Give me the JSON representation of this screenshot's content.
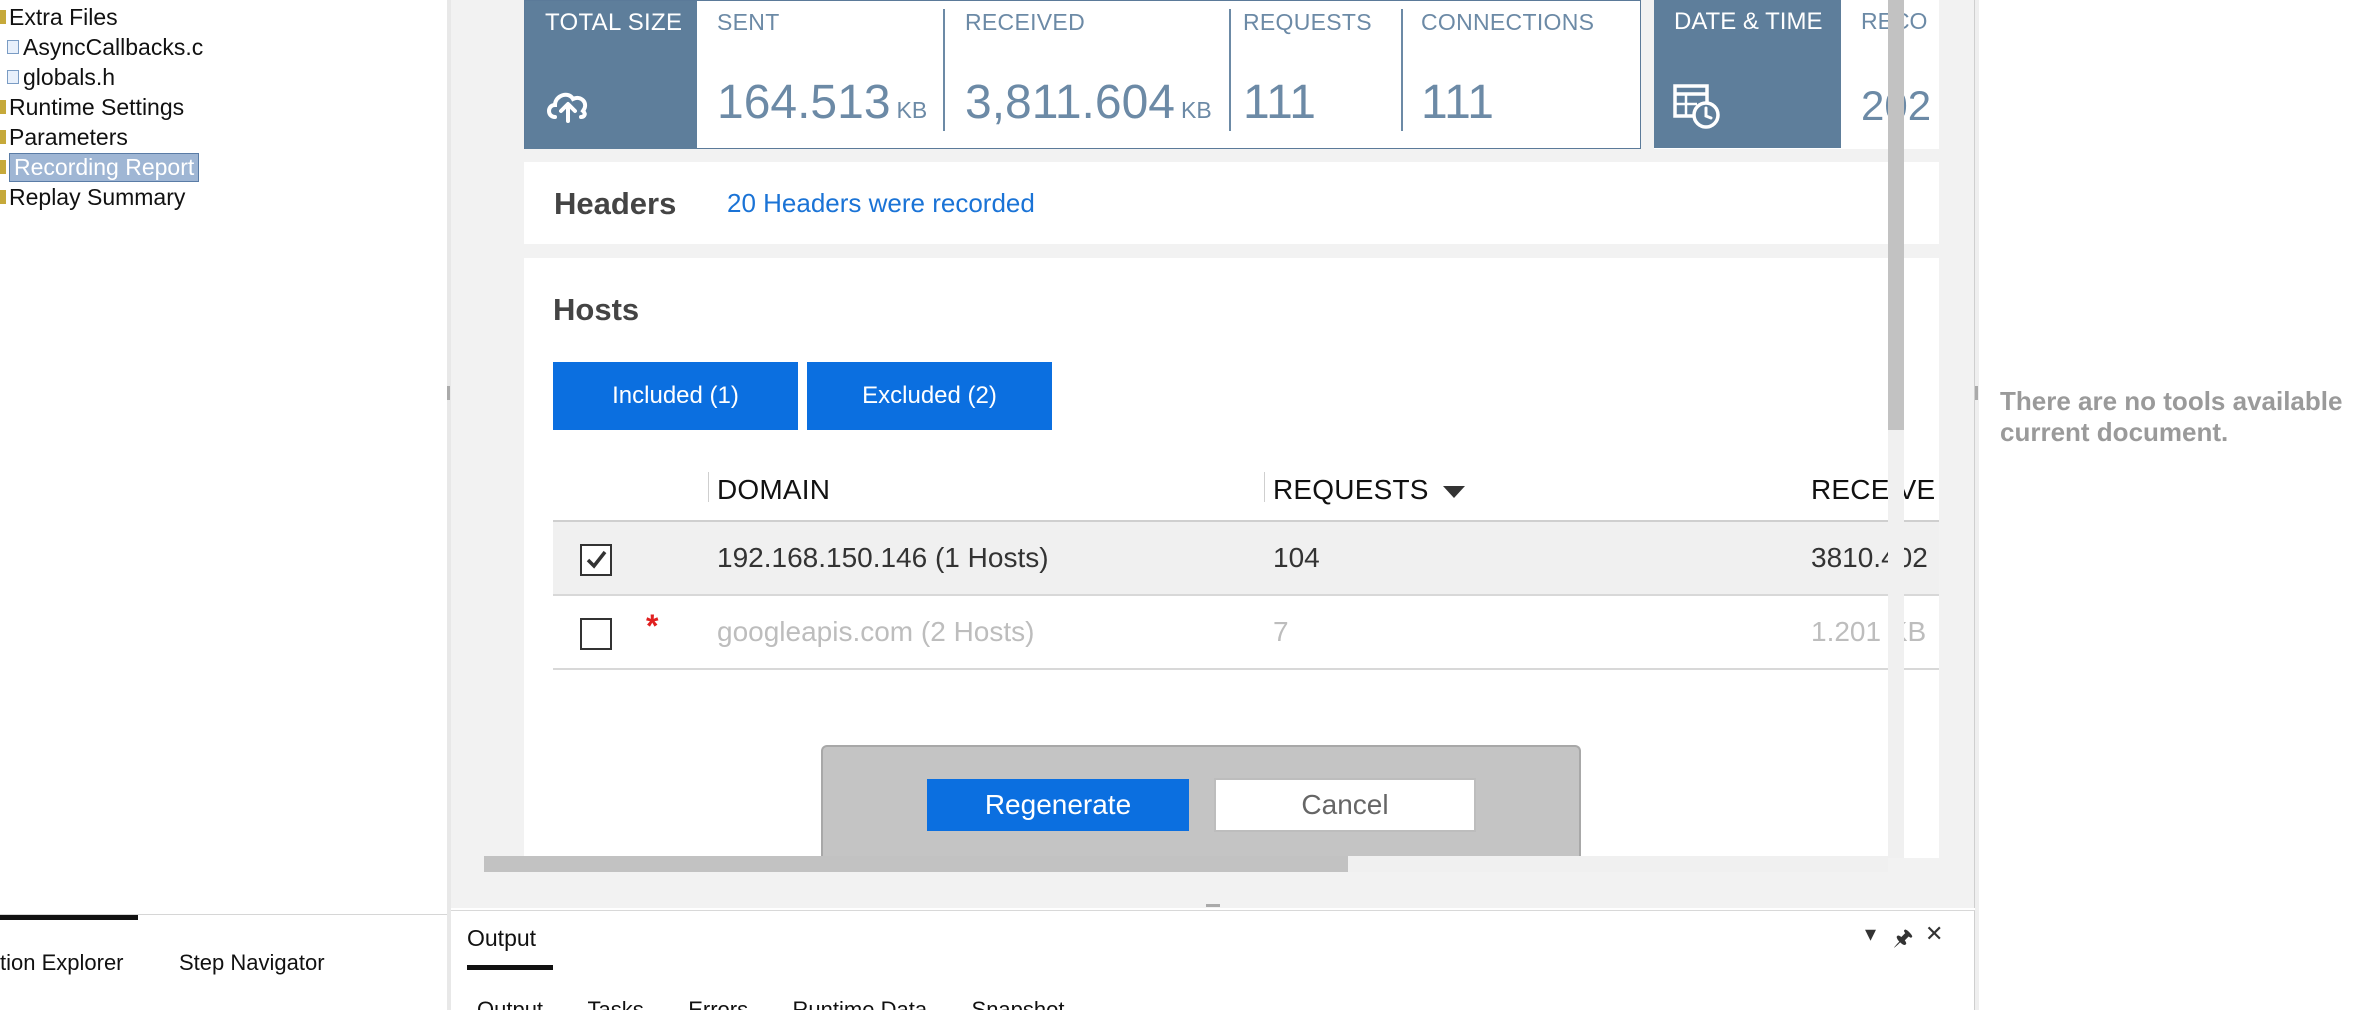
{
  "solution_tree": {
    "items": [
      {
        "label": "Extra Files",
        "kind": "folder"
      },
      {
        "label": "AsyncCallbacks.c",
        "kind": "file"
      },
      {
        "label": "globals.h",
        "kind": "file"
      },
      {
        "label": "Runtime Settings",
        "kind": "folder"
      },
      {
        "label": "Parameters",
        "kind": "folder"
      },
      {
        "label": "Recording Report",
        "kind": "folder",
        "selected": true
      },
      {
        "label": "Replay Summary",
        "kind": "folder"
      }
    ]
  },
  "left_bottom_tabs": [
    "tion Explorer",
    "Step Navigator"
  ],
  "stats": {
    "total_size_label": "TOTAL SIZE",
    "sent_label": "SENT",
    "sent_value": "164.513",
    "sent_unit": "KB",
    "received_label": "RECEIVED",
    "received_value": "3,811.604",
    "received_unit": "KB",
    "requests_label": "REQUESTS",
    "requests_value": "111",
    "connections_label": "CONNECTIONS",
    "connections_value": "111",
    "date_time_label": "DATE & TIME",
    "recording_label": "RECO",
    "recording_value": "202"
  },
  "headers_section": {
    "title": "Headers",
    "link": "20 Headers were recorded"
  },
  "hosts_section": {
    "title": "Hosts",
    "included_button": "Included (1)",
    "excluded_button": "Excluded (2)",
    "columns": [
      "DOMAIN",
      "REQUESTS",
      "RECEIVE"
    ],
    "rows": [
      {
        "checked": true,
        "domain": "192.168.150.146 (1 Hosts)",
        "requests": "104",
        "received": "3810.402",
        "disabled": false
      },
      {
        "checked": false,
        "marker": "*",
        "domain": "googleapis.com (2 Hosts)",
        "requests": "7",
        "received": "1.201 KB",
        "disabled": true
      }
    ]
  },
  "dialog": {
    "regenerate": "Regenerate",
    "cancel": "Cancel"
  },
  "output_panel": {
    "title": "Output",
    "tabs": [
      "Output",
      "Tasks",
      "Errors",
      "Runtime Data",
      "Snapshot"
    ]
  },
  "tools_panel": {
    "message": "There are no tools available current document."
  },
  "colors": {
    "accent_blue": "#0b6fe0",
    "stat_dark": "#5e7e9b",
    "stat_text": "#6c8aa6",
    "link_blue": "#1a73d6",
    "required_red": "#e02020"
  }
}
